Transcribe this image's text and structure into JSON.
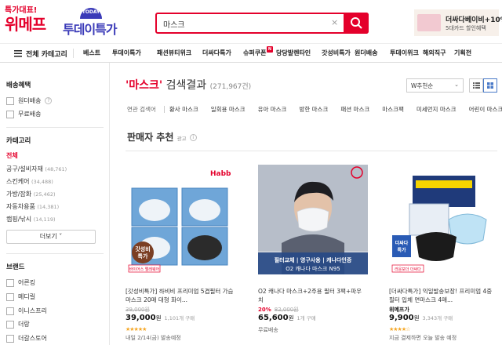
{
  "header": {
    "logo_small": "특가대표!",
    "logo_big": "위메프",
    "today_badge": "TODAY",
    "today_logo": "투데이특가",
    "search_value": "마스크",
    "clear_glyph": "×",
    "promo_title": "더싸다베이비+10%",
    "promo_sub": "5대카드 할인혜택"
  },
  "nav": {
    "all_categories": "전체 카테고리",
    "items": [
      "베스트",
      "투데이특가",
      "패션뷰티위크",
      "더싸다특가",
      "슈퍼쿠폰",
      "당당발렌타인",
      "갓성비특가",
      "원더배송",
      "투데이위크",
      "해외직구",
      "기획전"
    ],
    "coupon_badge": "N"
  },
  "sidebar": {
    "shipping_title": "배송혜택",
    "shipping_options": [
      "원더배송",
      "무료배송"
    ],
    "help_glyph": "?",
    "category_title": "카테고리",
    "categories": [
      {
        "label": "전체",
        "count": ""
      },
      {
        "label": "공구/설비자재",
        "count": "(48,761)"
      },
      {
        "label": "스킨케어",
        "count": "(34,488)"
      },
      {
        "label": "가방/잡화",
        "count": "(25,462)"
      },
      {
        "label": "자동차용품",
        "count": "(14,381)"
      },
      {
        "label": "캠핑/낚시",
        "count": "(14,119)"
      }
    ],
    "more_label": "더보기 ˅",
    "brand_title": "브랜드",
    "brands": [
      "어른킹",
      "메디릴",
      "이니스프리",
      "더랑",
      "더갈스토어"
    ]
  },
  "results": {
    "keyword": "'마스크'",
    "suffix": " 검색결과",
    "count": "(271,967건)",
    "sort_label": "W추천순",
    "sort_arrow": "⌄",
    "related_label": "연관 검색어",
    "related": [
      "황사 마스크",
      "일회용 마스크",
      "유아 마스크",
      "방한 마스크",
      "패션 마스크",
      "마스크팩",
      "미세먼지 마스크",
      "어린이 마스크"
    ]
  },
  "recommend": {
    "title": "판매자 추천",
    "ad_label": "광고",
    "info_glyph": "i"
  },
  "products": [
    {
      "title": "[갓성비특가] 하비비 프리미엄 5겹필터 가슴마스크 20매 대형 화이...",
      "discount": "",
      "original": "39,000원",
      "price": "39,000",
      "won": "원",
      "buy_count": "1,101개 구매",
      "stars": "★★★★★",
      "shipping": "내일 2/14(금) 발송예정",
      "img_brand": "Habb",
      "badge_text": "갓성비\n특가",
      "tag_text": "바이어스 엘레웨어"
    },
    {
      "title": "O2 캐나다 마스크+2주용 필터 3팩+파우치",
      "discount": "20%",
      "original": "82,000원",
      "price": "65,600",
      "won": "원",
      "buy_count": "1개 구매",
      "stars": "",
      "shipping": "무료배송",
      "img_caption1": "필터교체 | 영구사용 | 캐나다인증",
      "img_caption2": "O2 캐나다 마스크 N95"
    },
    {
      "title": "[더싸다특가] 익일발송보장! 프리미엄 4중필터 입체 면마스크 4매...",
      "discount": "",
      "original": "위메프가",
      "price": "9,900",
      "won": "원",
      "buy_count": "3,343개 구매",
      "stars": "★★★★☆",
      "shipping": "지금 결제하면 오늘 발송 예정",
      "badge_text": "더싸다\n특가",
      "tag_text": "라운보더 더싸다"
    }
  ]
}
